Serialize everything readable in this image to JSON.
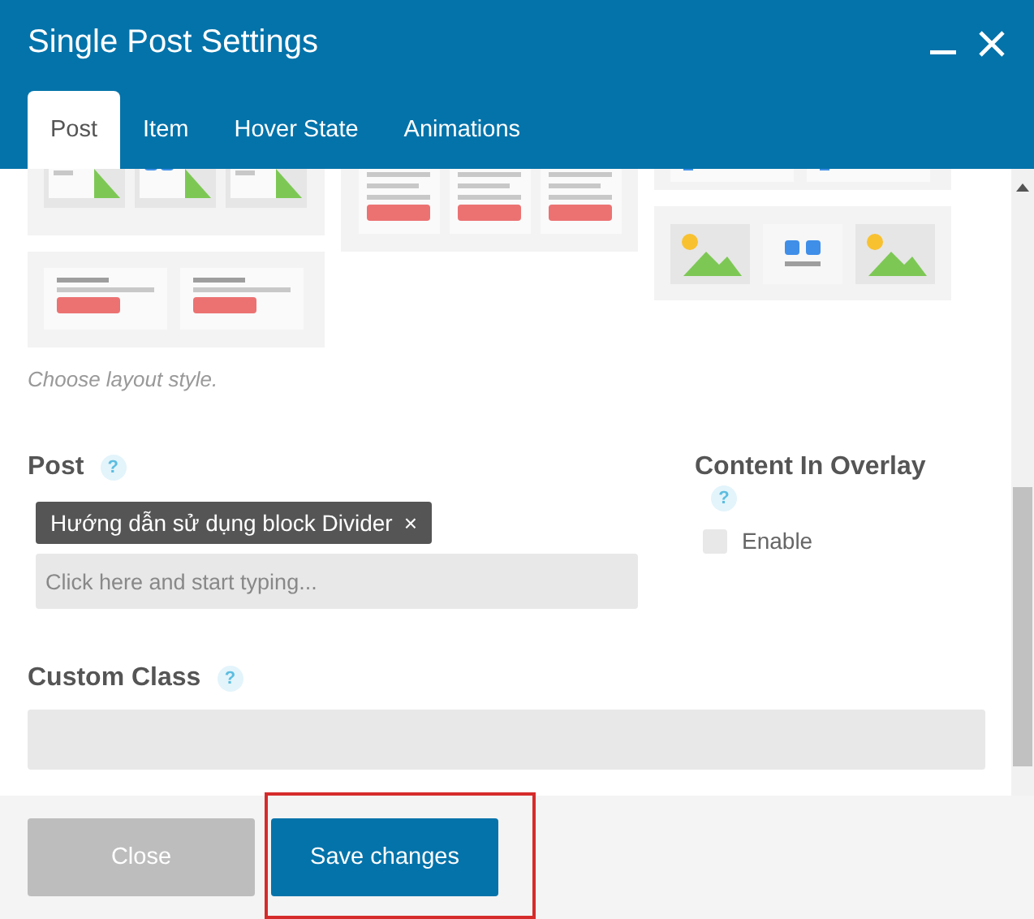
{
  "window": {
    "title": "Single Post Settings"
  },
  "tabs": [
    {
      "label": "Post",
      "selected": true
    },
    {
      "label": "Item",
      "selected": false
    },
    {
      "label": "Hover State",
      "selected": false
    },
    {
      "label": "Animations",
      "selected": false
    }
  ],
  "layout_picker": {
    "columns": [
      [
        {
          "kind": "image-tiles"
        },
        {
          "kind": "text-pair"
        }
      ],
      [
        {
          "kind": "text-trio"
        }
      ],
      [
        {
          "kind": "text-row"
        },
        {
          "kind": "image-row"
        }
      ]
    ],
    "hint": "Choose layout style."
  },
  "post": {
    "label": "Post",
    "help": "?",
    "tags": [
      {
        "label": "Hướng dẫn sử dụng block Divider",
        "remove": "×"
      }
    ],
    "placeholder": "Click here and start typing..."
  },
  "content_in_overlay": {
    "label": "Content In Overlay",
    "help": "?",
    "checkbox": {
      "label": "Enable",
      "checked": false
    }
  },
  "custom_class": {
    "label": "Custom Class",
    "help": "?"
  },
  "buttons": [
    {
      "label": "Close",
      "kind": "secondary"
    },
    {
      "label": "Save changes",
      "kind": "primary"
    }
  ]
}
